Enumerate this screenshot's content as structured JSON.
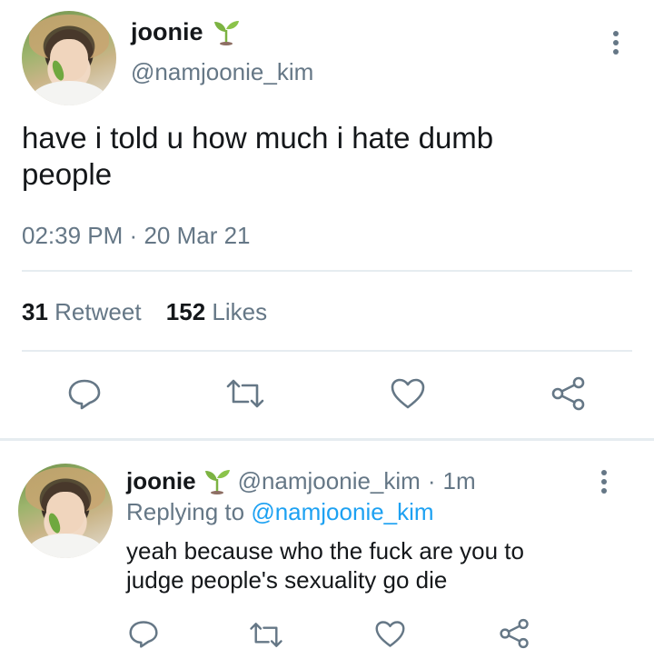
{
  "main_tweet": {
    "display_name": "joonie",
    "handle": "@namjoonie_kim",
    "text_line1": "have i told u how much i hate dumb",
    "text_line2": "people",
    "time": "02:39 PM",
    "separator": "·",
    "date": "20 Mar 21",
    "retweet_count": "31",
    "retweet_label": "Retweet",
    "like_count": "152",
    "like_label": "Likes"
  },
  "reply_tweet": {
    "display_name": "joonie",
    "handle": "@namjoonie_kim",
    "separator": "·",
    "age": "1m",
    "replying_prefix": "Replying to",
    "replying_handle": "@namjoonie_kim",
    "text_line1": "yeah because who the fuck are you to",
    "text_line2": "judge people's sexuality go die"
  },
  "icons": {
    "name_emoji": "seedling-icon",
    "reply": "reply-icon",
    "retweet": "retweet-icon",
    "like": "heart-icon",
    "share": "share-icon",
    "more": "more-vertical-icon"
  },
  "colors": {
    "text": "#14171a",
    "muted": "#657786",
    "link": "#1da1f2",
    "divider": "#e6ecf0",
    "seedling_leaf": "#7cb342",
    "seedling_soil": "#8d6e63"
  }
}
